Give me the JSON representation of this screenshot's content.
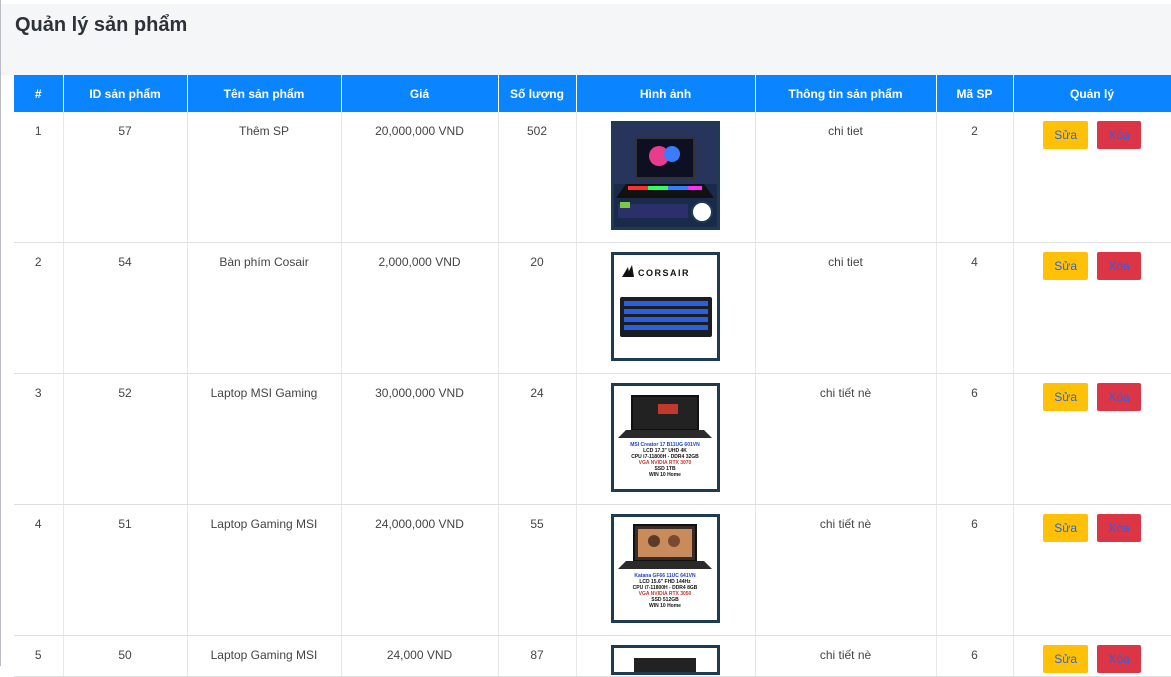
{
  "page": {
    "title": "Quản lý sản phẩm"
  },
  "table": {
    "headers": [
      "#",
      "ID sản phẩm",
      "Tên sản phẩm",
      "Giá",
      "Số lượng",
      "Hình ảnh",
      "Thông tin sản phẩm",
      "Mã SP",
      "Quản lý"
    ],
    "edit_label": "Sửa",
    "delete_label": "Xóa",
    "rows": [
      {
        "index": "1",
        "id": "57",
        "name": "Thêm SP",
        "price": "20,000,000 VND",
        "qty": "502",
        "info": "chi tiet",
        "code": "2",
        "image": "gaming-laptop-promo"
      },
      {
        "index": "2",
        "id": "54",
        "name": "Bàn phím Cosair",
        "price": "2,000,000 VND",
        "qty": "20",
        "info": "chi tiet",
        "code": "4",
        "image": "corsair-keyboard",
        "image_text": "CORSAIR"
      },
      {
        "index": "3",
        "id": "52",
        "name": "Laptop MSI Gaming",
        "price": "30,000,000 VND",
        "qty": "24",
        "info": "chi tiết nè",
        "code": "6",
        "image": "msi-creator-laptop",
        "spec_lines": [
          "MSI Creator 17 B11UG 601VN",
          "LCD 17.3\" UHD 4K",
          "CPU i7-11800H - DDR4 32GB",
          "VGA NVIDIA RTX 3070",
          "SSD 1TB",
          "WIN 10 Home"
        ]
      },
      {
        "index": "4",
        "id": "51",
        "name": "Laptop Gaming MSI",
        "price": "24,000,000 VND",
        "qty": "55",
        "info": "chi tiết nè",
        "code": "6",
        "image": "msi-katana-laptop",
        "spec_lines": [
          "Katana GF66 11UC 641VN",
          "LCD 15.6\" FHD 144Hz",
          "CPU i7-11800H - DDR4 8GB",
          "VGA NVIDIA RTX 3050",
          "SSD 512GB",
          "WIN 10 Home"
        ]
      },
      {
        "index": "5",
        "id": "50",
        "name": "Laptop Gaming MSI",
        "price": "24,000 VND",
        "qty": "87",
        "info": "chi tiết nè",
        "code": "6",
        "image": "laptop"
      }
    ]
  },
  "colors": {
    "header_bg": "#0b85ff",
    "edit_btn": "#ffc107",
    "delete_btn": "#dc3545",
    "btn_text": "#2563eb"
  }
}
